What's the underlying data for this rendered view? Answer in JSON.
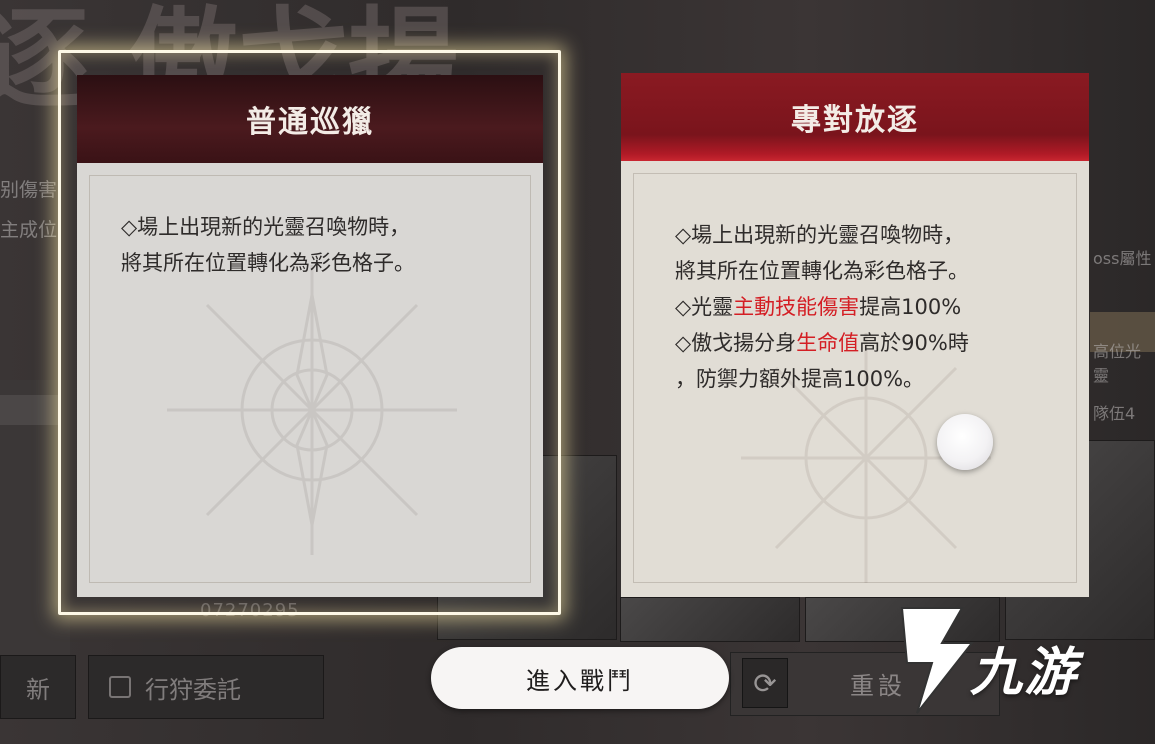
{
  "background": {
    "title_fragment": "逐.傲戈揚",
    "left_lines": [
      "别傷害",
      "主成位"
    ],
    "filter_button_label": "新",
    "commission_button_label": "行狩委託",
    "serial_number": "07270295",
    "right_lines": [
      "oss屬性",
      "高位光靈",
      "隊伍4"
    ]
  },
  "cards": {
    "normal": {
      "title": "普通巡獵",
      "lines": [
        "◇場上出現新的光靈召喚物時，",
        "將其所在位置轉化為彩色格子。"
      ]
    },
    "exile": {
      "title": "專對放逐",
      "line1": "◇場上出現新的光靈召喚物時，",
      "line2": "將其所在位置轉化為彩色格子。",
      "line3_prefix": "◇光靈",
      "line3_highlight": "主動技能傷害",
      "line3_suffix": "提高100%",
      "line4_prefix": "◇傲戈揚分身",
      "line4_highlight": "生命值",
      "line4_suffix": "高於90%時",
      "line5": "，防禦力額外提高100%。"
    }
  },
  "buttons": {
    "enter_battle": "進入戰鬥",
    "reset": "重設"
  },
  "watermark": {
    "text": "九游"
  },
  "colors": {
    "highlight": "#d41e24",
    "selected_glow": "#fdf8e6",
    "normal_header": "#3a1216",
    "exile_header": "#8a1a22"
  }
}
